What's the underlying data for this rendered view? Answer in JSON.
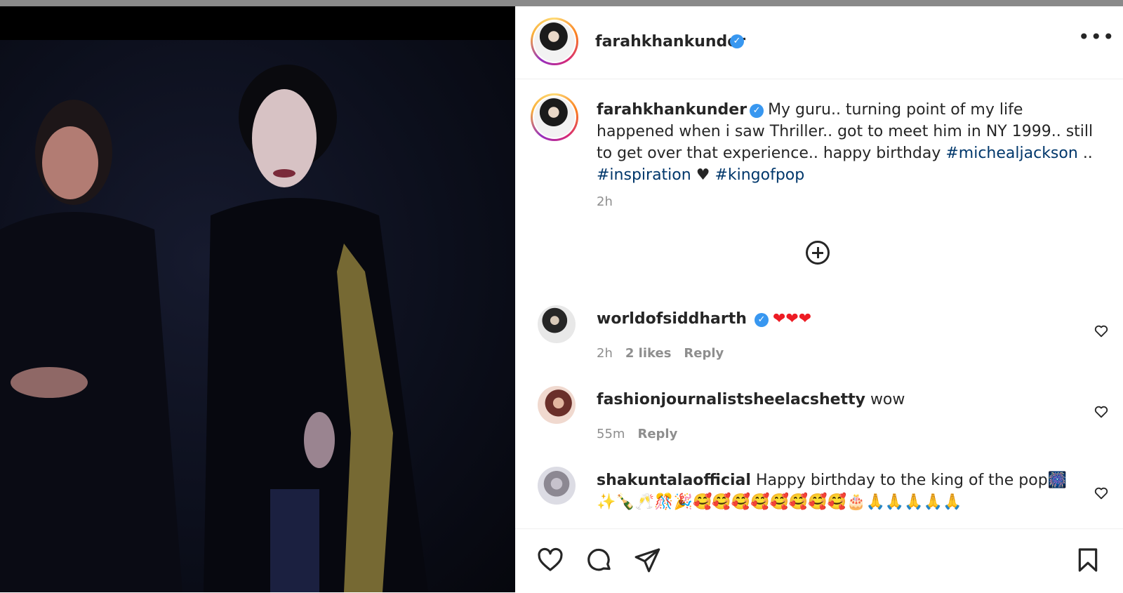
{
  "post": {
    "author": "farahkhankunder",
    "menu_label": "•••",
    "caption_text": "My guru.. turning point of my life happened when i saw Thriller.. got to meet him in NY 1999.. still to get over that experience.. happy birthday",
    "hashtag1": "#michealjackson",
    "sep": "..",
    "hashtag2": "#inspiration",
    "heart": "♥",
    "hashtag3": "#kingofpop",
    "time": "2h"
  },
  "comments": [
    {
      "user": "worldofsiddharth",
      "text": "❤❤❤",
      "time": "2h",
      "likes": "2 likes",
      "reply": "Reply"
    },
    {
      "user": "fashionjournalistsheelacshetty",
      "text": "wow",
      "time": "55m",
      "reply": "Reply"
    },
    {
      "user": "shakuntalaofficial",
      "text": "Happy birthday to the king of the pop🎆✨🍾🥂🎊🎉🥰🥰🥰🥰🥰🥰🥰🥰🎂🙏🙏🙏🙏🙏"
    }
  ],
  "colors": {
    "link": "#00376b",
    "verified": "#3897f0",
    "muted": "#8e8e8e"
  },
  "icons": [
    "verified-badge-icon",
    "more-options-icon",
    "load-more-comments-icon",
    "like-icon",
    "comment-icon",
    "share-icon",
    "save-icon",
    "comment-like-icon"
  ]
}
